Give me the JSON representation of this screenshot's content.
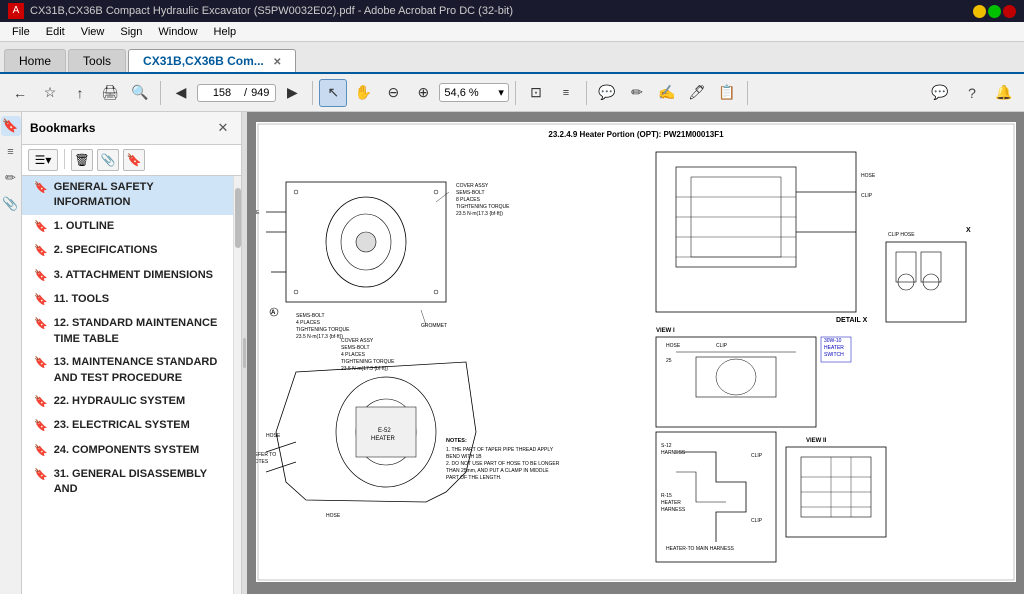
{
  "titleBar": {
    "title": "CX31B,CX36B Compact Hydraulic Excavator (S5PW0032E02).pdf - Adobe Acrobat Pro DC (32-bit)",
    "appIcon": "A"
  },
  "menuBar": {
    "items": [
      "File",
      "Edit",
      "View",
      "Sign",
      "Window",
      "Help"
    ]
  },
  "tabs": [
    {
      "label": "Home",
      "active": false
    },
    {
      "label": "Tools",
      "active": false
    },
    {
      "label": "CX31B,CX36B Com...",
      "active": true,
      "closeable": true
    }
  ],
  "toolbar": {
    "navButtons": [
      "⬅",
      "☆",
      "↑",
      "🖨",
      "🔍"
    ],
    "pageBack": "◁",
    "pageForward": "▷",
    "pageInput": "158",
    "pageSeparator": "/",
    "pageTotal": "949",
    "toolButtons": [
      "↖",
      "✋",
      "⊖",
      "⊕"
    ],
    "zoomInput": "54,6%",
    "fitButtons": [
      "⊡",
      "≡",
      "💬",
      "✏",
      "✍",
      "🖊",
      "📋"
    ],
    "extraTools": [
      "💬",
      "?",
      "🔔"
    ]
  },
  "sidebar": {
    "title": "Bookmarks",
    "closeBtn": "✕",
    "toolbarBtns": [
      "☰▾",
      "🗑",
      "📎",
      "🔖"
    ],
    "bookmarks": [
      {
        "label": "GENERAL SAFETY INFORMATION",
        "active": true
      },
      {
        "label": "1. OUTLINE",
        "active": false
      },
      {
        "label": "2. SPECIFICATIONS",
        "active": false
      },
      {
        "label": "3. ATTACHMENT DIMENSIONS",
        "active": false
      },
      {
        "label": "11. TOOLS",
        "active": false
      },
      {
        "label": "12. STANDARD MAINTENANCE TIME TABLE",
        "active": false
      },
      {
        "label": "13. MAINTENANCE STANDARD AND TEST PROCEDURE",
        "active": false
      },
      {
        "label": "22. HYDRAULIC SYSTEM",
        "active": false
      },
      {
        "label": "23. ELECTRICAL SYSTEM",
        "active": false
      },
      {
        "label": "24. COMPONENTS SYSTEM",
        "active": false
      },
      {
        "label": "31. GENERAL DISASSEMBLY AND",
        "active": false
      }
    ]
  },
  "leftIcons": [
    "🔖",
    "🔗",
    "🖊",
    "📎"
  ],
  "drawing": {
    "title": "23.2.4.9 Heater Portion (OPT): PW21M00013F1"
  }
}
